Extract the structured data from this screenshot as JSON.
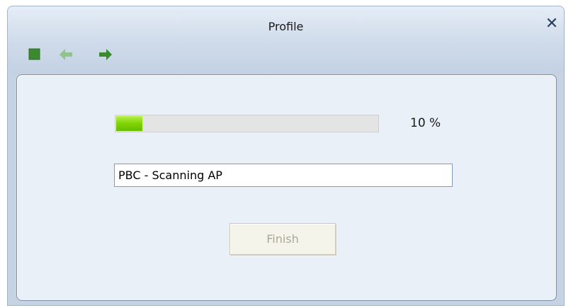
{
  "window": {
    "title": "Profile",
    "close_label": "✕"
  },
  "toolbar": {
    "icons": [
      "stop-icon",
      "back-arrow-icon",
      "forward-arrow-icon"
    ]
  },
  "progress": {
    "value_fraction": 0.1,
    "percent_text": "10 %",
    "fill_color": "#7fd300"
  },
  "status": {
    "value": "PBC - Scanning AP"
  },
  "buttons": {
    "finish_label": "Finish",
    "finish_enabled": false
  },
  "colors": {
    "window_bg": "#c6d3e3",
    "panel_bg": "#eaf0f8",
    "icon_green": "#3c8a2f",
    "icon_green_disabled": "#8fc48a"
  }
}
